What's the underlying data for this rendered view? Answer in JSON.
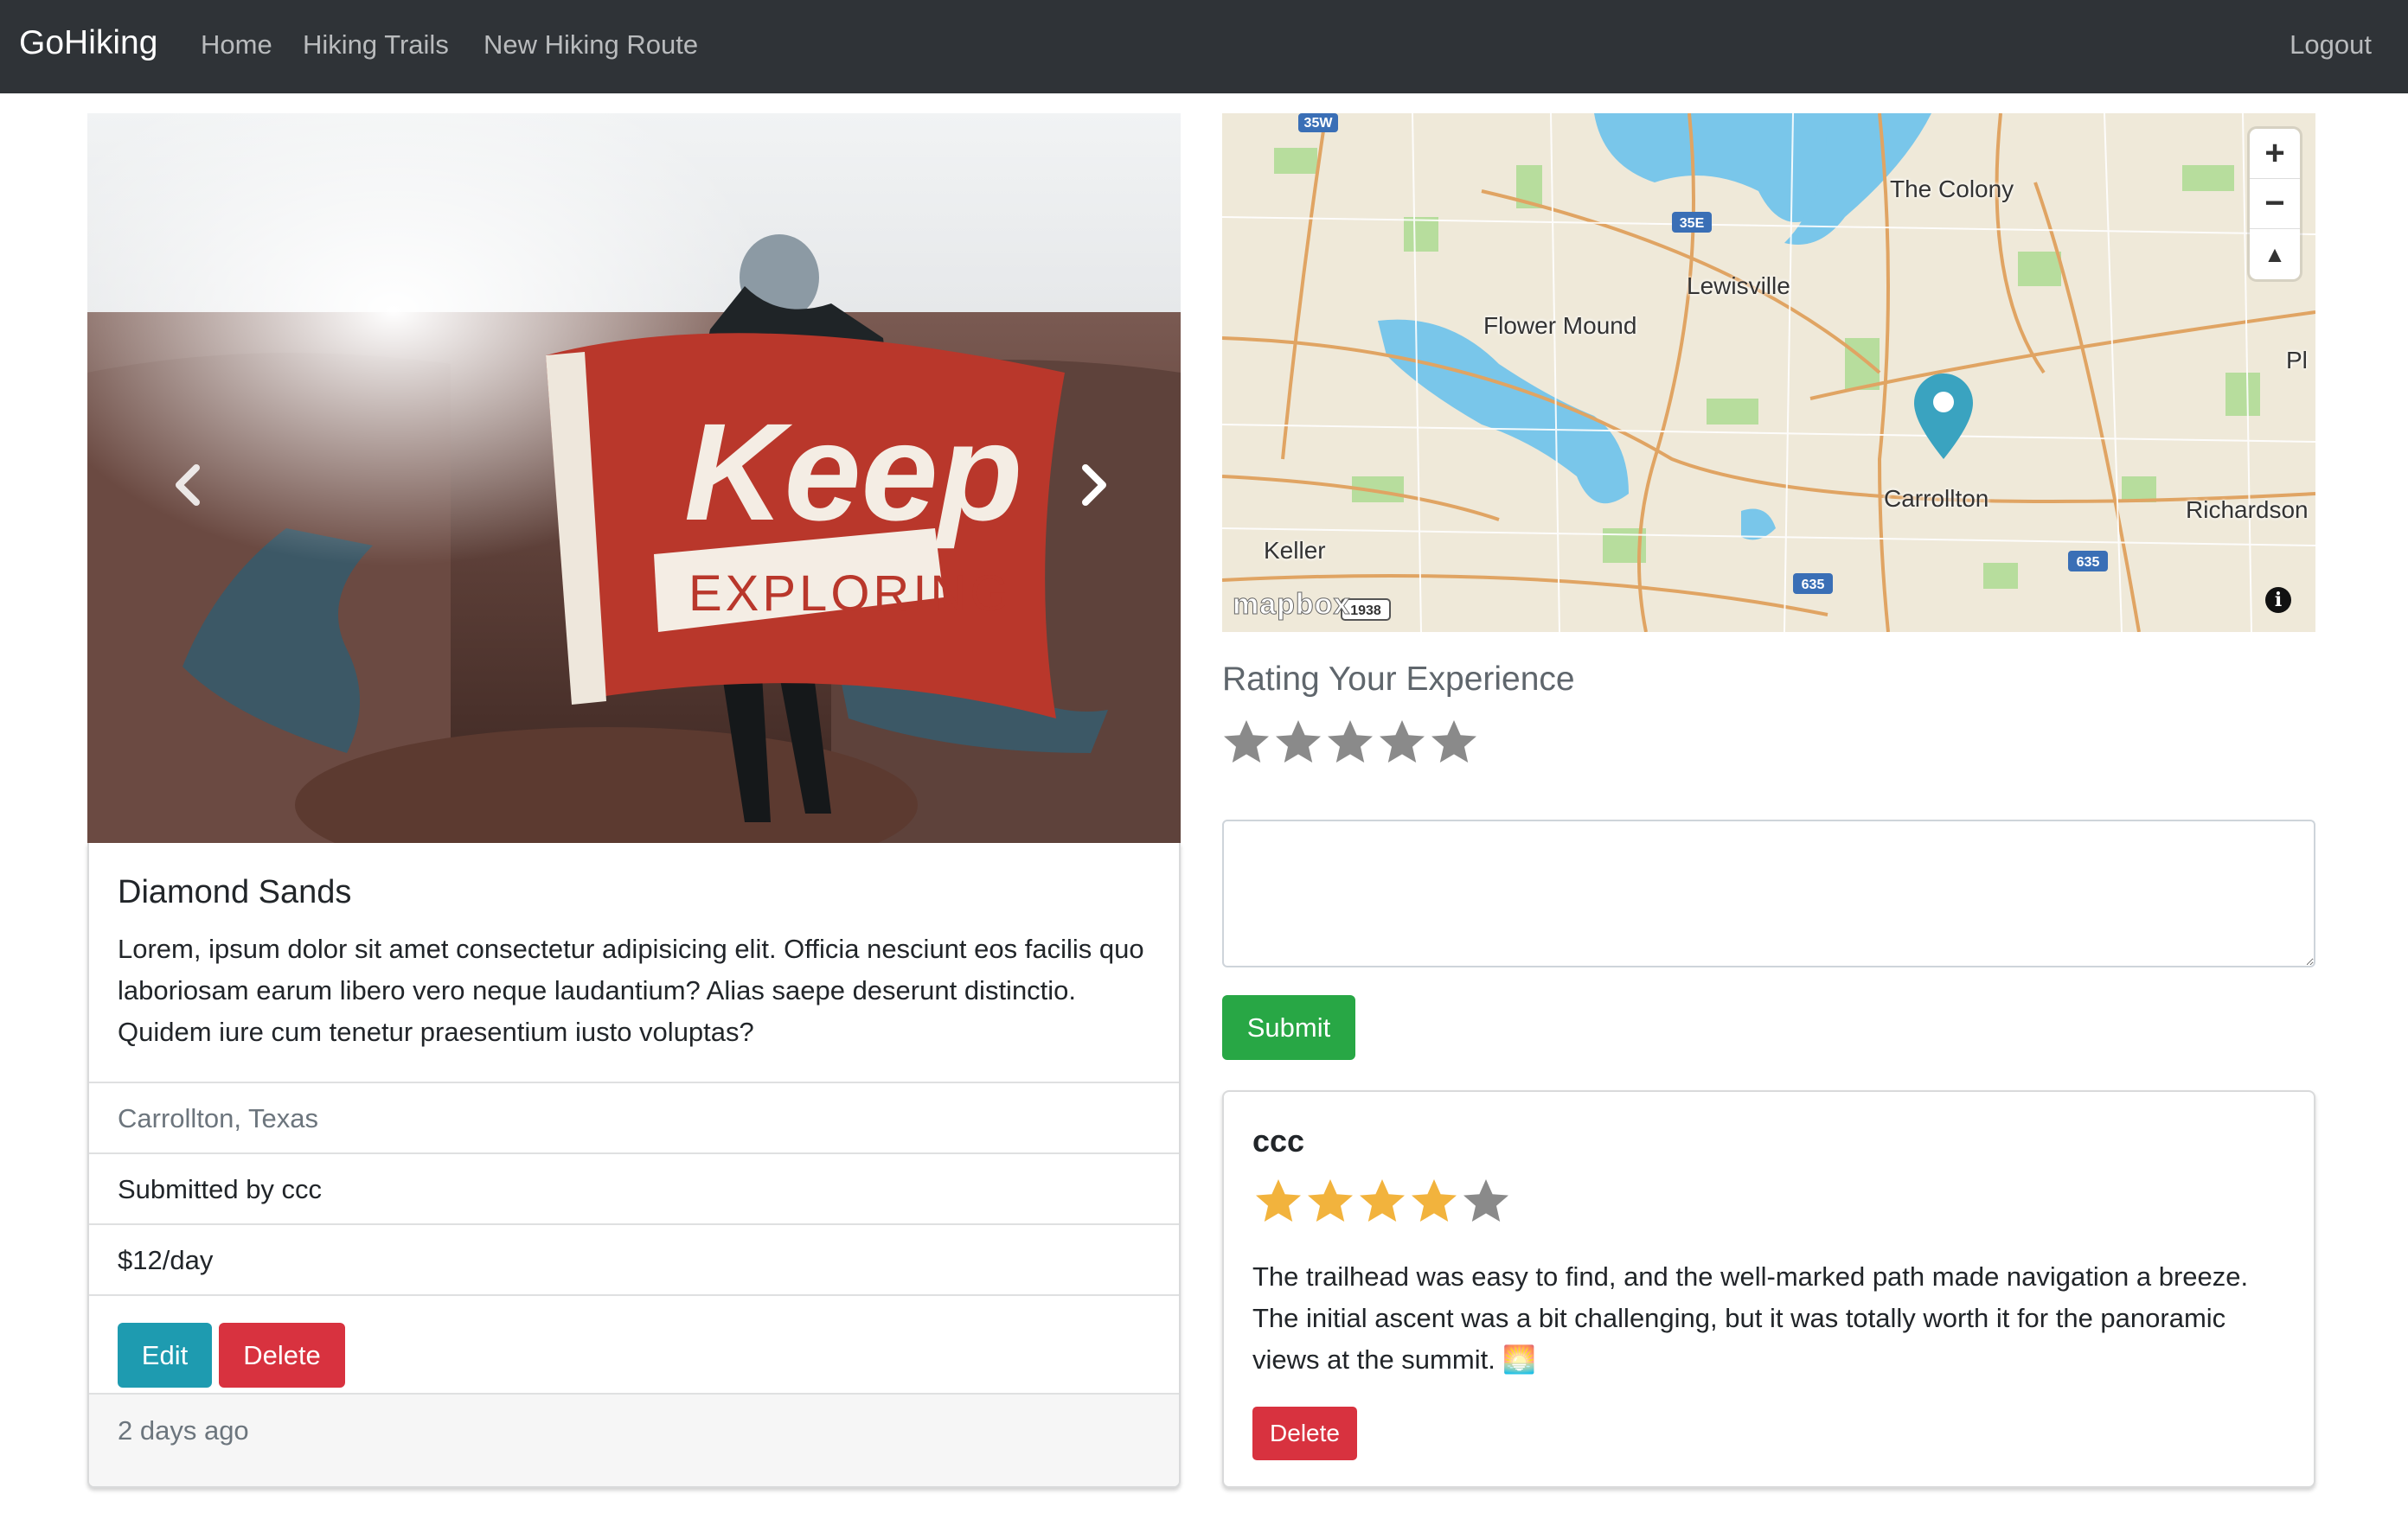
{
  "navbar": {
    "brand": "GoHiking",
    "links": [
      "Home",
      "Hiking Trails",
      "New Hiking Route"
    ],
    "logout": "Logout"
  },
  "campground": {
    "title": "Diamond Sands",
    "description": "Lorem, ipsum dolor sit amet consectetur adipisicing elit. Officia nesciunt eos facilis quo laboriosam earum libero vero neque laudantium? Alias saepe deserunt distinctio. Quidem iure cum tenetur praesentium iusto voluptas?",
    "location": "Carrollton, Texas",
    "submitted_by": "Submitted by ccc",
    "price": "$12/day",
    "edit_label": "Edit",
    "delete_label": "Delete",
    "posted": "2 days ago",
    "image_flag_text": [
      "Keep",
      "EXPLORING"
    ]
  },
  "map": {
    "labels": [
      "The Colony",
      "Lewisville",
      "Flower Mound",
      "Carrollton",
      "Richardson",
      "Keller",
      "Pl"
    ],
    "highway_shields": [
      "35W",
      "35E",
      "635",
      "635",
      "1938"
    ],
    "logo_text": "mapbox",
    "zoom_in": "+",
    "zoom_out": "−",
    "compass": "▲",
    "info": "i"
  },
  "rating_form": {
    "title": "Rating Your Experience",
    "stars_selected": 0,
    "stars_max": 5,
    "review_value": "",
    "submit_label": "Submit"
  },
  "reviews": [
    {
      "user": "ccc",
      "rating": 4,
      "rating_max": 5,
      "body": "The trailhead was easy to find, and the well-marked path made navigation a breeze. The initial ascent was a bit challenging, but it was totally worth it for the panoramic views at the summit. 🌅",
      "delete_label": "Delete"
    }
  ],
  "colors": {
    "navbar_bg": "#2f3337",
    "edit_button": "#1e9bb0",
    "delete_button": "#d8323f",
    "submit_button": "#28a745",
    "star_filled": "#f2b33d",
    "star_empty": "#8a8a8a",
    "map_pin": "#3aa3c0"
  }
}
